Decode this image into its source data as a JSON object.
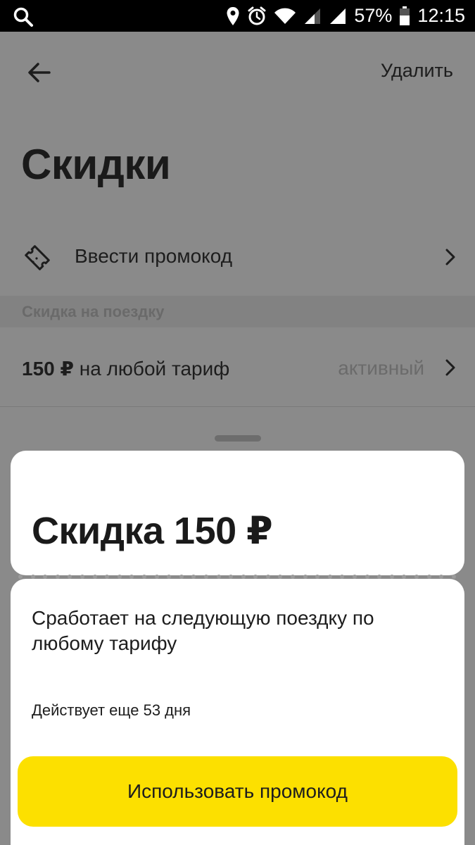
{
  "status_bar": {
    "battery_percent": "57%",
    "time": "12:15",
    "icons": [
      "search-icon",
      "location-icon",
      "alarm-icon",
      "wifi-icon",
      "signal-icon",
      "signal-icon",
      "battery-icon"
    ]
  },
  "app_bar": {
    "back_icon": "arrow-left-icon",
    "delete_label": "Удалить"
  },
  "page": {
    "title": "Скидки"
  },
  "promo_row": {
    "icon": "ticket-icon",
    "label": "Ввести промокод"
  },
  "section": {
    "label": "Скидка на поездку"
  },
  "discount_row": {
    "amount": "150 ₽",
    "label": "на любой тариф",
    "status": "активный"
  },
  "sheet": {
    "title": "Скидка 150 ₽",
    "description": "Сработает на следующую поездку по любому тарифу",
    "validity": "Действует еще 53 дня",
    "button_label": "Использовать промокод"
  },
  "colors": {
    "accent": "#fce000",
    "overlay_background": "#8a8a8a",
    "card": "#ffffff",
    "text": "#1d1d1d"
  }
}
